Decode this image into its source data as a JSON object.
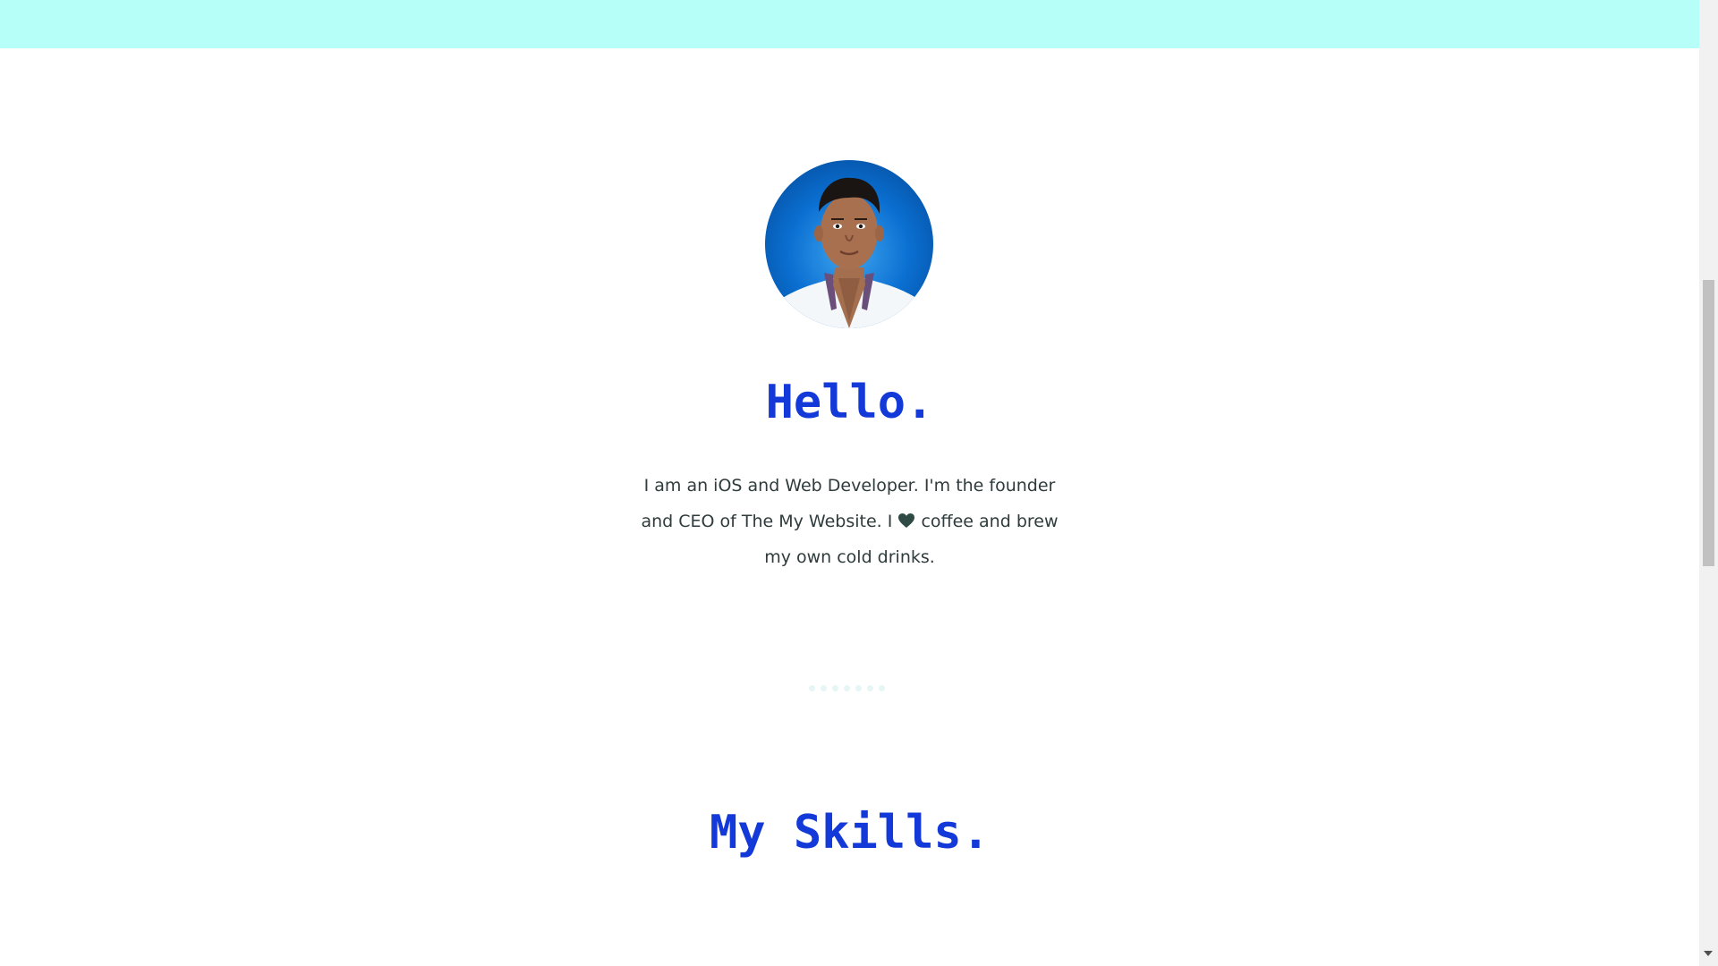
{
  "header": {
    "band_color": "#b6fef8"
  },
  "profile": {
    "avatar_icon": "profile-photo",
    "heading": "Hello.",
    "intro_part1": "I am an iOS and Web Developer. I'm the founder and CEO of The My Website. I",
    "intro_heart_icon": "heart-icon",
    "intro_part2": "coffee and brew my own cold drinks."
  },
  "divider": {
    "dot_count": 7,
    "dot_color": "#e6f6f5"
  },
  "skills": {
    "heading": "My Skills."
  },
  "colors": {
    "heading": "#1339d8",
    "body_text": "#2f3b3c",
    "heart": "#2f4a45"
  }
}
